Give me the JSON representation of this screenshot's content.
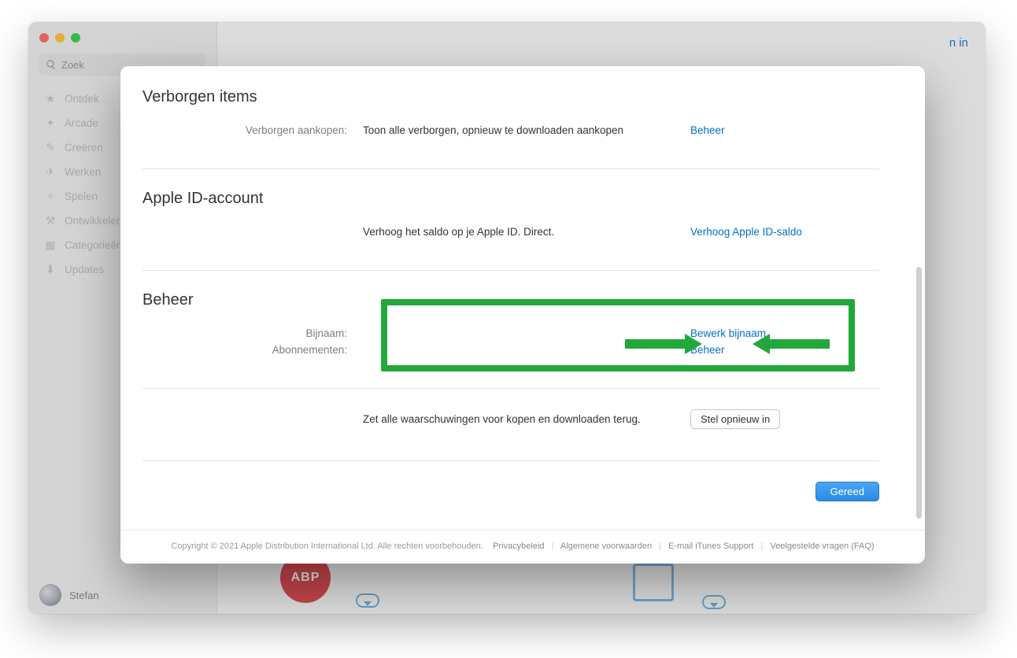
{
  "sidebar": {
    "search_placeholder": "Zoek",
    "items": [
      {
        "icon": "★",
        "label": "Ontdek"
      },
      {
        "icon": "✦",
        "label": "Arcade"
      },
      {
        "icon": "✎",
        "label": "Creëren"
      },
      {
        "icon": "✈",
        "label": "Werken"
      },
      {
        "icon": "✧",
        "label": "Spelen"
      },
      {
        "icon": "⚒",
        "label": "Ontwikkelen"
      },
      {
        "icon": "▦",
        "label": "Categorieën"
      },
      {
        "icon": "⬇",
        "label": "Updates"
      }
    ],
    "user_name": "Stefan"
  },
  "header": {
    "login_fragment": "n in"
  },
  "modal": {
    "sections": {
      "hidden": {
        "title": "Verborgen items",
        "row_label": "Verborgen aankopen:",
        "row_value": "Toon alle verborgen, opnieuw te downloaden aankopen",
        "row_action": "Beheer"
      },
      "apple_id": {
        "title": "Apple ID-account",
        "row_value": "Verhoog het saldo op je Apple ID. Direct.",
        "row_action": "Verhoog Apple ID-saldo"
      },
      "manage": {
        "title": "Beheer",
        "nickname_label": "Bijnaam:",
        "nickname_action": "Bewerk bijnaam",
        "subs_label": "Abonnementen:",
        "subs_action": "Beheer"
      },
      "reset": {
        "text": "Zet alle waarschuwingen voor kopen en downloaden terug.",
        "button": "Stel opnieuw in"
      }
    },
    "done_button": "Gereed",
    "legal": {
      "copyright": "Copyright © 2021 Apple Distribution International Ltd. Alle rechten voorbehouden.",
      "links": [
        "Privacybeleid",
        "Algemene voorwaarden",
        "E-mail iTunes Support",
        "Veelgestelde vragen (FAQ)"
      ]
    }
  },
  "bg_art": {
    "abp": "ABP"
  }
}
